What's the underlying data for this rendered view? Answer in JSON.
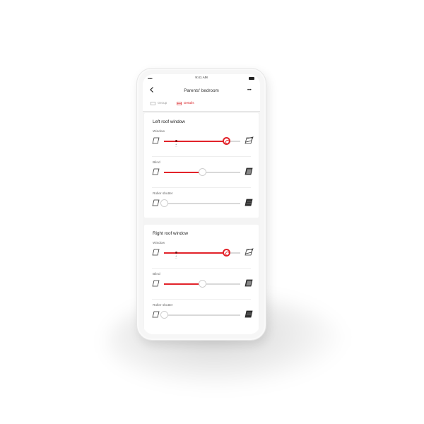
{
  "status_bar": {
    "signal": "•••••",
    "time": "9:41 AM"
  },
  "nav": {
    "title": "Parents' bedroom",
    "more": "•••"
  },
  "tabs": [
    {
      "label": "Group",
      "active": false
    },
    {
      "label": "Details",
      "active": true
    }
  ],
  "colors": {
    "accent": "#e2232a",
    "track": "#d9d9d9"
  },
  "windows": [
    {
      "title": "Left roof window",
      "controls": [
        {
          "label": "Window",
          "value_percent": 82,
          "marker_percent": 16,
          "marker_label": "▲\n—",
          "active": true,
          "icon_left": "window-closed-icon",
          "icon_right": "window-open-icon"
        },
        {
          "label": "Blind",
          "value_percent": 50,
          "active": false,
          "icon_left": "blind-open-icon",
          "icon_right": "blind-closed-icon"
        },
        {
          "label": "Roller shutter",
          "value_percent": 0,
          "active": false,
          "icon_left": "shutter-open-icon",
          "icon_right": "shutter-closed-icon"
        }
      ]
    },
    {
      "title": "Right roof window",
      "controls": [
        {
          "label": "Window",
          "value_percent": 82,
          "marker_percent": 16,
          "marker_label": "▲\n—",
          "active": true,
          "icon_left": "window-closed-icon",
          "icon_right": "window-open-icon"
        },
        {
          "label": "Blind",
          "value_percent": 50,
          "active": false,
          "icon_left": "blind-open-icon",
          "icon_right": "blind-closed-icon"
        },
        {
          "label": "Roller shutter",
          "value_percent": 0,
          "active": false,
          "icon_left": "shutter-open-icon",
          "icon_right": "shutter-closed-icon"
        }
      ]
    }
  ]
}
